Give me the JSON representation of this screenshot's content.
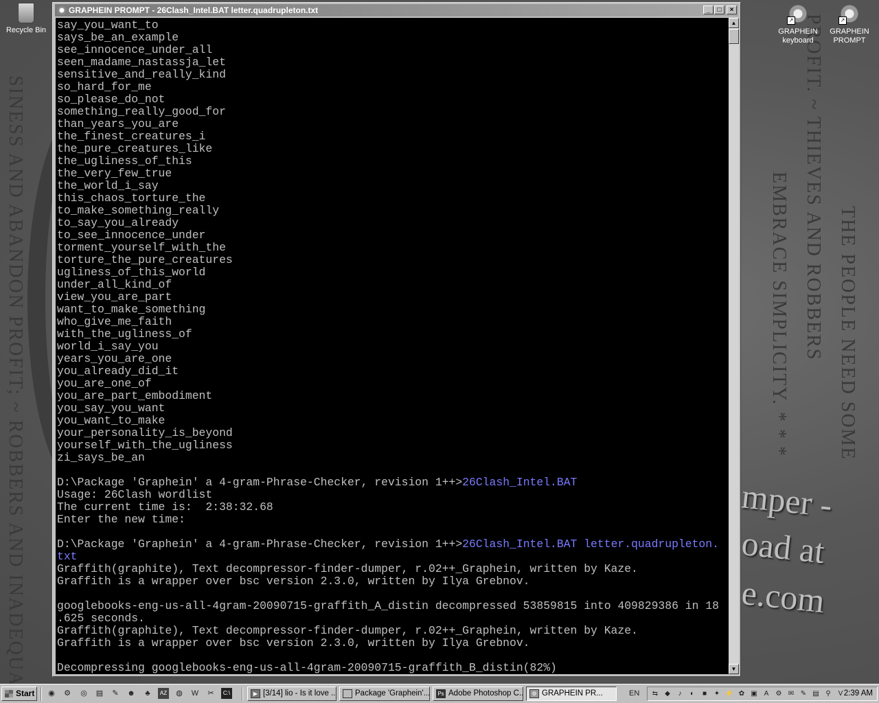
{
  "desktop": {
    "icons": {
      "recycle_bin": "Recycle Bin",
      "graphein_keyboard": "GRAPHEIN keyboard",
      "graphein_prompt": "GRAPHEIN PROMPT"
    },
    "wallpaper": {
      "big1": "mper -",
      "big2": "oad at",
      "big3": "e.com"
    }
  },
  "window": {
    "title": "GRAPHEIN PROMPT - 26Clash_Intel.BAT letter.quadrupleton.txt",
    "btn_minimize": "_",
    "btn_maximize": "□",
    "btn_close": "×"
  },
  "console": {
    "wordlist": [
      "say_you_want_to",
      "says_be_an_example",
      "see_innocence_under_all",
      "seen_madame_nastassja_let",
      "sensitive_and_really_kind",
      "so_hard_for_me",
      "so_please_do_not",
      "something_really_good_for",
      "than_years_you_are",
      "the_finest_creatures_i",
      "the_pure_creatures_like",
      "the_ugliness_of_this",
      "the_very_few_true",
      "the_world_i_say",
      "this_chaos_torture_the",
      "to_make_something_really",
      "to_say_you_already",
      "to_see_innocence_under",
      "torment_yourself_with_the",
      "torture_the_pure_creatures",
      "ugliness_of_this_world",
      "under_all_kind_of",
      "view_you_are_part",
      "want_to_make_something",
      "who_give_me_faith",
      "with_the_ugliness_of",
      "world_i_say_you",
      "years_you_are_one",
      "you_already_did_it",
      "you_are_one_of",
      "you_are_part_embodiment",
      "you_say_you_want",
      "you_want_to_make",
      "your_personality_is_beyond",
      "yourself_with_the_ugliness",
      "zi_says_be_an"
    ],
    "prompt": "D:\\Package 'Graphein' a 4-gram-Phrase-Checker, revision 1++>",
    "cmd1": "26Clash_Intel.BAT",
    "usage": "Usage: 26Clash wordlist",
    "current_time": "The current time is:  2:38:32.68",
    "enter_time": "Enter the new time:",
    "cmd2_a": "26Clash_Intel.BAT letter.quadrupleton.",
    "cmd2_b": "txt",
    "graffith1": "Graffith(graphite), Text decompressor-finder-dumper, r.02++_Graphein, written by Kaze.",
    "graffith2": "Graffith is a wrapper over bsc version 2.3.0, written by Ilya Grebnov.",
    "decomp_a": "googlebooks-eng-us-all-4gram-20090715-graffith_A_distin decompressed 53859815 into 409829386 in 18",
    "decomp_b": ".625 seconds.",
    "graffith3": "Graffith(graphite), Text decompressor-finder-dumper, r.02++_Graphein, written by Kaze.",
    "graffith4": "Graffith is a wrapper over bsc version 2.3.0, written by Ilya Grebnov.",
    "decompressing": "Decompressing googlebooks-eng-us-all-4gram-20090715-graffith_B_distin(82%)"
  },
  "taskbar": {
    "start": "Start",
    "tasks": [
      "[3/14] lio - Is it love ...",
      "Package 'Graphein'...",
      "Adobe Photoshop C...",
      "GRAPHEIN PR..."
    ],
    "language": "EN",
    "clock": "2:39 AM"
  }
}
